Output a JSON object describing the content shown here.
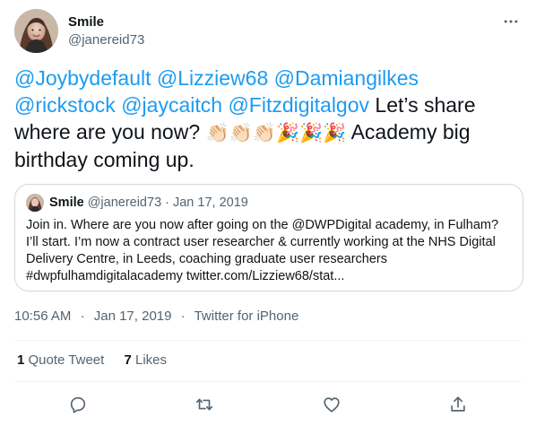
{
  "tweet": {
    "author": {
      "name": "Smile",
      "handle": "@janereid73"
    },
    "body": {
      "mentions": [
        "@Joybydefault",
        "@Lizziew68",
        "@Damiangilkes",
        "@rickstock",
        "@jaycaitch",
        "@Fitzdigitalgov"
      ],
      "text_1": "Let’s share where are you now?",
      "emojis": [
        "👏🏻",
        "👏🏻",
        "👏🏻",
        "🎉",
        "🎉",
        "🎉"
      ],
      "text_2": "Academy big birthday coming up."
    },
    "quote": {
      "name": "Smile",
      "handle": "@janereid73",
      "separator": "·",
      "date": "Jan 17, 2019",
      "text": "Join in. Where are you now after going on the @DWPDigital academy, in Fulham? I’ll start. I’m now a contract user researcher & currently working at the NHS Digital Delivery Centre, in Leeds, coaching graduate user researchers #dwpfulhamdigitalacademy twitter.com/Lizziew68/stat..."
    },
    "meta": {
      "time": "10:56 AM",
      "separator": "·",
      "date": "Jan 17, 2019",
      "source": "Twitter for iPhone"
    },
    "stats": {
      "quote_tweets_count": "1",
      "quote_tweets_label": "Quote Tweet",
      "likes_count": "7",
      "likes_label": "Likes"
    },
    "icons": {
      "more": "more-horizontal-icon",
      "reply": "reply-icon",
      "retweet": "retweet-icon",
      "like": "heart-icon",
      "share": "share-icon"
    },
    "colors": {
      "accent": "#1d9bf0",
      "text": "#0f1419",
      "secondary_text": "#536471",
      "border": "#cfd9de"
    }
  }
}
